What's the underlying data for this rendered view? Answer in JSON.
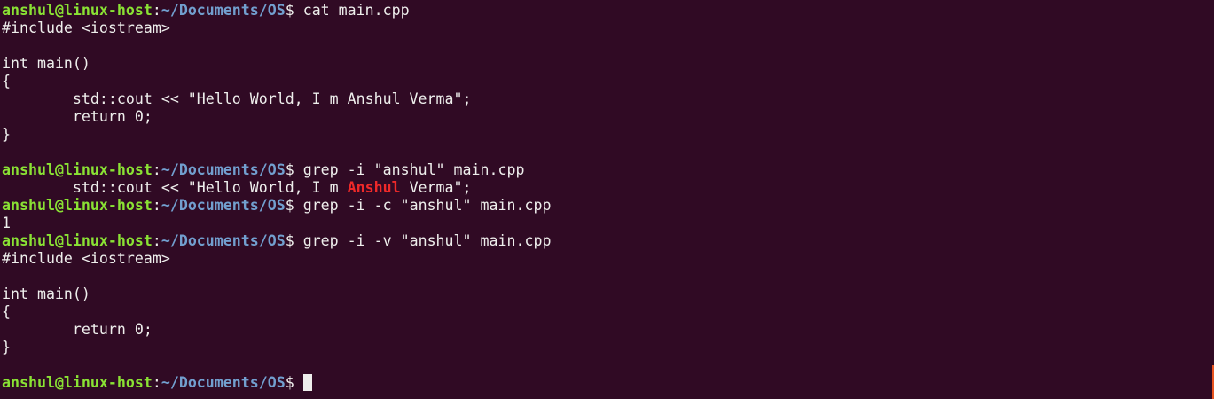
{
  "prompt": {
    "user_host": "anshul@linux-host",
    "sep": ":",
    "path": "~/Documents/OS",
    "symbol": "$ "
  },
  "commands": [
    "cat main.cpp",
    "grep -i \"anshul\" main.cpp",
    "grep -i -c \"anshul\" main.cpp",
    "grep -i -v \"anshul\" main.cpp"
  ],
  "cat_output": [
    "#include <iostream>",
    "",
    "int main()",
    "{",
    "        std::cout << \"Hello World, I m Anshul Verma\";",
    "        return 0;",
    "}",
    ""
  ],
  "grep_match": {
    "before": "        std::cout << \"Hello World, I m ",
    "match": "Anshul",
    "after": " Verma\";"
  },
  "count_output": "1",
  "invert_output": [
    "#include <iostream>",
    "",
    "int main()",
    "{",
    "        return 0;",
    "}",
    ""
  ],
  "colors": {
    "background": "#300a24",
    "user": "#8ae234",
    "path": "#729fcf",
    "match": "#ef2929",
    "scrollbar": "#e95420"
  }
}
